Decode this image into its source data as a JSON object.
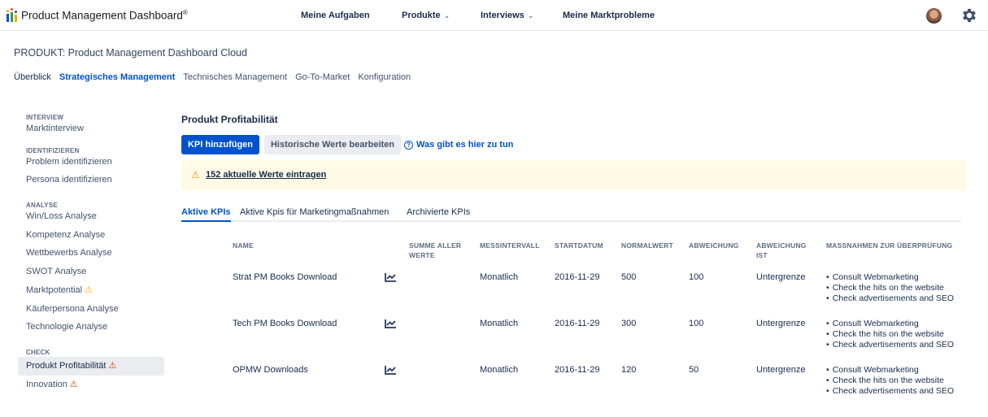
{
  "app": {
    "title": "Product Management Dashboard",
    "title_mark": "®"
  },
  "topnav": {
    "items": [
      "Meine Aufgaben",
      "Produkte",
      "Interviews",
      "Meine Marktprobleme"
    ]
  },
  "project": {
    "title": "PRODUKT: Product Management Dashboard Cloud",
    "tabs": [
      "Überblick",
      "Strategisches Management",
      "Technisches Management",
      "Go-To-Market",
      "Konfiguration"
    ]
  },
  "sidebar": {
    "sections": [
      {
        "heading": "INTERVIEW",
        "items": [
          "Marktinterview"
        ]
      },
      {
        "heading": "IDENTIFIZIEREN",
        "items": [
          "Problem identifizieren",
          "Persona identifizieren"
        ]
      },
      {
        "heading": "ANALYSE",
        "items": [
          "Win/Loss Analyse",
          "Kompetenz Analyse",
          "Wettbewerbs Analyse",
          "SWOT Analyse",
          "Marktpotential",
          "Käuferpersona Analyse",
          "Technologie Analyse"
        ]
      },
      {
        "heading": "CHECK",
        "items": [
          "Produkt Profitabilität",
          "Innovation"
        ]
      }
    ]
  },
  "main": {
    "title": "Produkt Profitabilität",
    "add_kpi_label": "KPI hinzufügen",
    "edit_history_label": "Historische Werte bearbeiten",
    "help_label": "Was gibt es hier zu tun",
    "banner_text": "152 aktuelle Werte eintragen",
    "subtabs": [
      "Aktive KPIs",
      "Aktive Kpis für Marketingmaßnahmen",
      "Archivierte KPIs"
    ]
  },
  "table": {
    "headers": {
      "name": "NAME",
      "sum1": "SUMME ALLER",
      "sum2": "WERTE",
      "interval": "MESSINTERVALL",
      "start": "STARTDATUM",
      "normal": "NORMALWERT",
      "deviation": "ABWEICHUNG",
      "dev_is1": "ABWEICHUNG",
      "dev_is2": "IST",
      "measures": "MASSNAHMEN ZUR ÜBERPRÜFUNG"
    },
    "rows": [
      {
        "name": "Strat PM Books Download",
        "interval": "Monatlich",
        "start": "2016-11-29",
        "normal": "500",
        "deviation": "100",
        "dev_is": "Untergrenze",
        "measures": [
          "Consult Webmarketing",
          "Check the hits on the website",
          "Check advertisements and SEO"
        ]
      },
      {
        "name": "Tech PM Books Download",
        "interval": "Monatlich",
        "start": "2016-11-29",
        "normal": "300",
        "deviation": "100",
        "dev_is": "Untergrenze",
        "measures": [
          "Consult Webmarketing",
          "Check the hits on the website",
          "Check advertisements and SEO"
        ]
      },
      {
        "name": "OPMW Downloads",
        "interval": "Monatlich",
        "start": "2016-11-29",
        "normal": "120",
        "deviation": "50",
        "dev_is": "Untergrenze",
        "measures": [
          "Consult Webmarketing",
          "Check the hits on the website",
          "Check advertisements and SEO"
        ]
      }
    ]
  },
  "icons": {
    "chart_row": "chart-line-icon",
    "warning": "warning-icon",
    "error": "error-icon",
    "help": "help-circle-icon",
    "settings": "gear-icon"
  },
  "colors": {
    "primary": "#0052cc",
    "banner_bg": "#fffae6",
    "warning": "#ffab00",
    "error": "#de350b"
  }
}
